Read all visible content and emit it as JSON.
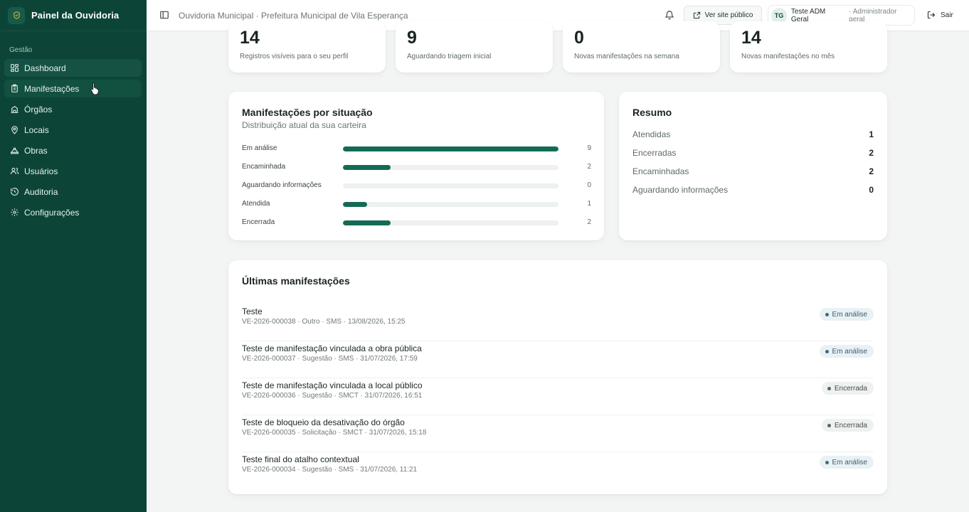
{
  "sidebar": {
    "brand": "Painel da Ouvidoria",
    "group_label": "Gestão",
    "items": [
      {
        "label": "Dashboard",
        "icon": "dashboard-icon"
      },
      {
        "label": "Manifestações",
        "icon": "clipboard-icon"
      },
      {
        "label": "Órgãos",
        "icon": "building-icon"
      },
      {
        "label": "Locais",
        "icon": "map-pin-icon"
      },
      {
        "label": "Obras",
        "icon": "hard-hat-icon"
      },
      {
        "label": "Usuários",
        "icon": "users-icon"
      },
      {
        "label": "Auditoria",
        "icon": "history-icon"
      },
      {
        "label": "Configurações",
        "icon": "gear-icon"
      }
    ]
  },
  "header": {
    "breadcrumb": "Ouvidoria Municipal · Prefeitura Municipal de Vila Esperança",
    "public_site_label": "Ver site público",
    "user_initials": "TG",
    "user_name": "Teste ADM Geral",
    "user_role": "· Administrador geral",
    "logout_label": "Sair"
  },
  "stats": [
    {
      "value": "14",
      "label": "Registros visíveis para o seu perfil"
    },
    {
      "value": "9",
      "label": "Aguardando triagem inicial"
    },
    {
      "value": "0",
      "label": "Novas manifestações na semana"
    },
    {
      "value": "14",
      "label": "Novas manifestações no mês"
    }
  ],
  "situation": {
    "title": "Manifestações por situação",
    "subtitle": "Distribuição atual da sua carteira",
    "rows": [
      {
        "label": "Em análise",
        "count": "9"
      },
      {
        "label": "Encaminhada",
        "count": "2"
      },
      {
        "label": "Aguardando informações",
        "count": "0"
      },
      {
        "label": "Atendida",
        "count": "1"
      },
      {
        "label": "Encerrada",
        "count": "2"
      }
    ]
  },
  "chart_data": {
    "type": "bar",
    "title": "Manifestações por situação",
    "subtitle": "Distribuição atual da sua carteira",
    "categories": [
      "Em análise",
      "Encaminhada",
      "Aguardando informações",
      "Atendida",
      "Encerrada"
    ],
    "values": [
      9,
      2,
      0,
      1,
      2
    ],
    "xlim": [
      0,
      9
    ]
  },
  "resumo": {
    "title": "Resumo",
    "rows": [
      {
        "label": "Atendidas",
        "value": "1"
      },
      {
        "label": "Encerradas",
        "value": "2"
      },
      {
        "label": "Encaminhadas",
        "value": "2"
      },
      {
        "label": "Aguardando informações",
        "value": "0"
      }
    ]
  },
  "latest": {
    "title": "Últimas manifestações",
    "items": [
      {
        "title": "Teste",
        "meta": "VE-2026-000038 · Outro · SMS · 13/08/2026, 15:25",
        "status": "Em análise"
      },
      {
        "title": "Teste de manifestação vinculada a obra pública",
        "meta": "VE-2026-000037 · Sugestão · SMS · 31/07/2026, 17:59",
        "status": "Em análise"
      },
      {
        "title": "Teste de manifestação vinculada a local público",
        "meta": "VE-2026-000036 · Sugestão · SMCT · 31/07/2026, 16:51",
        "status": "Encerrada"
      },
      {
        "title": "Teste de bloqueio da desativação do órgão",
        "meta": "VE-2026-000035 · Solicitação · SMCT · 31/07/2026, 15:18",
        "status": "Encerrada"
      },
      {
        "title": "Teste final do atalho contextual",
        "meta": "VE-2026-000034 · Sugestão · SMS · 31/07/2026, 11:21",
        "status": "Em análise"
      }
    ]
  },
  "colors": {
    "sidebar_bg": "#0c4538",
    "accent": "#146b55",
    "page_bg": "#f3f5f4"
  }
}
